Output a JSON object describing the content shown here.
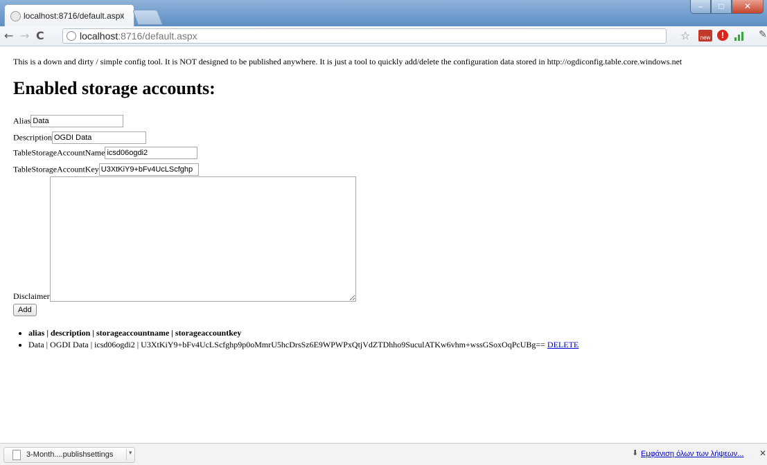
{
  "browser": {
    "tab_title": "localhost:8716/default.aspx",
    "tab_close": "×",
    "url_host": "localhost",
    "url_path": ":8716/default.aspx",
    "win_min": "–",
    "win_max": "□",
    "win_close": "✕"
  },
  "page": {
    "intro": "This is a down and dirty / simple config tool. It is NOT designed to be published anywhere. It is just a tool to quickly add/delete the configuration data stored in http://ogdiconfig.table.core.windows.net",
    "heading": "Enabled storage accounts:",
    "form": {
      "alias_label": "Alias",
      "alias_value": "Data",
      "description_label": "Description",
      "description_value": "OGDI Data",
      "account_name_label": "TableStorageAccountName",
      "account_name_value": "icsd06ogdi2",
      "account_key_label": "TableStorageAccountKey",
      "account_key_value": "U3XtKiY9+bFv4UcLScfghp",
      "disclaimer_label": "Disclaimer",
      "disclaimer_value": "",
      "add_label": "Add"
    },
    "list": {
      "header": "alias | description | storageaccountname | storageaccountkey",
      "rows": [
        {
          "text": "Data | OGDI Data | icsd06ogdi2 | U3XtKiY9+bFv4UcLScfghp9p0oMmrU5hcDrsSz6E9WPWPxQtjVdZTDhho9SuculATKw6vhm+wssGSoxOqPcUBg==",
          "delete_label": "DELETE"
        }
      ]
    }
  },
  "downloads": {
    "item_name": "3-Month....publishsettings",
    "show_all": "Εμφάνιση όλων των λήψεων...",
    "close": "✕"
  }
}
